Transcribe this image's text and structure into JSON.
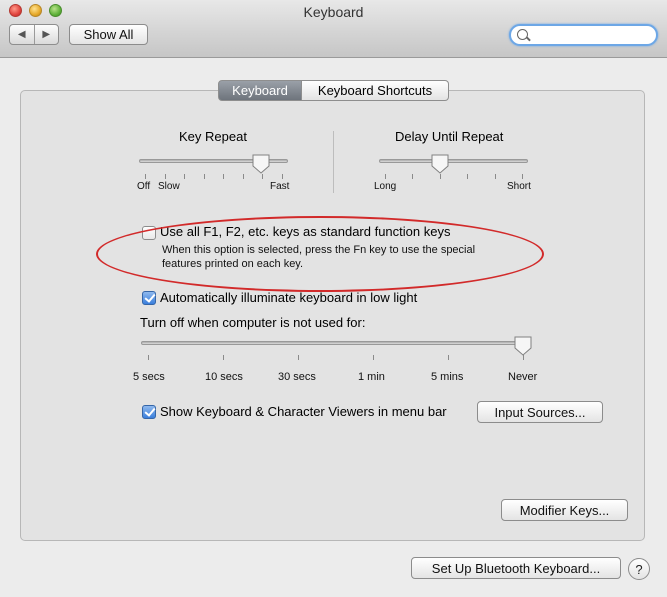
{
  "window": {
    "title": "Keyboard"
  },
  "toolbar": {
    "back": "◀",
    "forward": "▶",
    "show_all": "Show All",
    "search_placeholder": ""
  },
  "tabs": [
    {
      "label": "Keyboard",
      "selected": true
    },
    {
      "label": "Keyboard Shortcuts",
      "selected": false
    }
  ],
  "key_repeat": {
    "label": "Key Repeat",
    "min_label": "Off",
    "slow_label": "Slow",
    "max_label": "Fast",
    "value_fraction": 0.83,
    "tick_count": 8
  },
  "delay_until_repeat": {
    "label": "Delay Until Repeat",
    "min_label": "Long",
    "max_label": "Short",
    "value_fraction": 0.4,
    "tick_count": 6
  },
  "function_keys": {
    "label": "Use all F1, F2, etc. keys as standard function keys",
    "checked": false,
    "description_line1": "When this option is selected, press the Fn key to use the special",
    "description_line2": "features printed on each key."
  },
  "illumination": {
    "label": "Automatically illuminate keyboard in low light",
    "checked": true,
    "turn_off_label": "Turn off when computer is not used for:",
    "stops": [
      "5 secs",
      "10 secs",
      "30 secs",
      "1 min",
      "5 mins",
      "Never"
    ],
    "selected": "Never"
  },
  "viewers": {
    "label": "Show Keyboard & Character Viewers in menu bar",
    "checked": true,
    "input_sources_button": "Input Sources..."
  },
  "buttons": {
    "modifier_keys": "Modifier Keys...",
    "bluetooth": "Set Up Bluetooth Keyboard...",
    "help": "?"
  },
  "annotation": {
    "color": "#d22a2a"
  }
}
